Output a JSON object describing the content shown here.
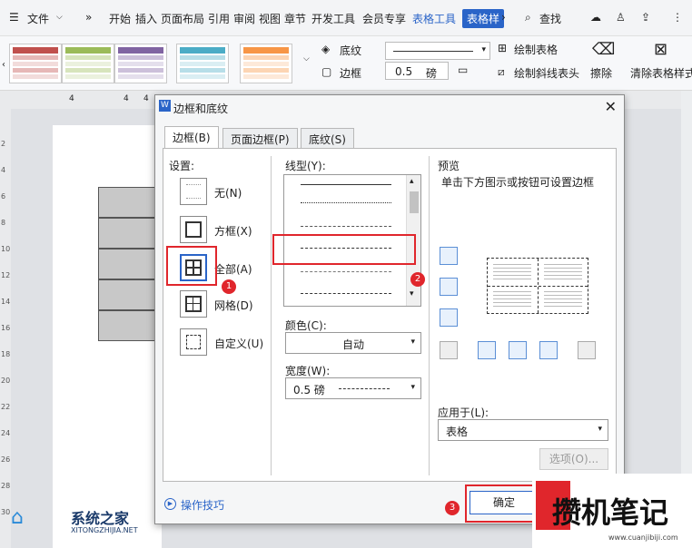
{
  "menubar": {
    "file": "文件",
    "items": [
      "开始",
      "插入",
      "页面布局",
      "引用",
      "审阅",
      "视图",
      "章节",
      "开发工具",
      "会员专享"
    ],
    "table_tools": "表格工具",
    "table_style": "表格样",
    "search": "查找"
  },
  "ribbon": {
    "shading": "底纹",
    "border": "边框",
    "line_width": "0.5",
    "unit": "磅",
    "draw_table": "绘制表格",
    "draw_diag": "绘制斜线表头",
    "erase": "擦除",
    "clear_style": "清除表格样式"
  },
  "ruler": {
    "marks": [
      "4",
      "4",
      "4"
    ]
  },
  "vruler": {
    "marks": [
      "2",
      "4",
      "6",
      "8",
      "10",
      "12",
      "14",
      "16",
      "18",
      "20",
      "22",
      "24",
      "26",
      "28",
      "30"
    ]
  },
  "dialog": {
    "title": "边框和底纹",
    "tabs": [
      "边框(B)",
      "页面边框(P)",
      "底纹(S)"
    ],
    "settings_label": "设置:",
    "settings": [
      "无(N)",
      "方框(X)",
      "全部(A)",
      "网格(D)",
      "自定义(U)"
    ],
    "linestyle_label": "线型(Y):",
    "color_label": "颜色(C):",
    "color_value": "自动",
    "width_label": "宽度(W):",
    "width_value": "0.5  磅",
    "preview_label": "预览",
    "preview_hint": "单击下方图示或按钮可设置边框",
    "apply_label": "应用于(L):",
    "apply_value": "表格",
    "options": "选项(O)...",
    "tips": "操作技巧",
    "ok": "确定"
  },
  "badges": [
    "1",
    "2",
    "3"
  ],
  "watermark": {
    "left_cn": "系统之家",
    "left_en": "XITONGZHIJIA.NET",
    "right_cn": "攒机笔记",
    "right_url": "www.cuanjibiji.com"
  }
}
